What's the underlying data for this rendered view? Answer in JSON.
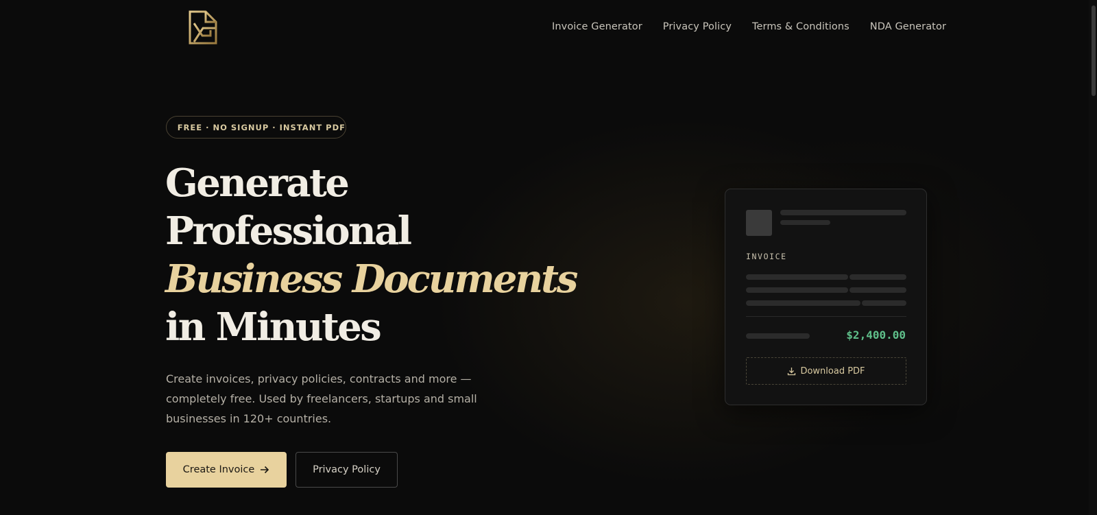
{
  "brand": {
    "logo_icon": "document-g-logo-icon",
    "accent_color": "#e8d29e",
    "amount_color": "#5fbf8a"
  },
  "nav": {
    "items": [
      {
        "label": "Invoice Generator"
      },
      {
        "label": "Privacy Policy"
      },
      {
        "label": "Terms & Conditions"
      },
      {
        "label": "NDA Generator"
      }
    ]
  },
  "hero": {
    "badge": "FREE · NO SIGNUP · INSTANT PDF",
    "badge_icon": "sparkle-icon",
    "headline": {
      "line1": "Generate",
      "line2": "Professional",
      "line3": "Business Documents",
      "line4": "in Minutes"
    },
    "subtext": "Create invoices, privacy policies, contracts and more — completely free. Used by freelancers, startups and small businesses in 120+ countries.",
    "primary_button": "Create Invoice",
    "primary_button_icon": "arrow-right-icon",
    "secondary_button": "Privacy Policy"
  },
  "invoice_card": {
    "label": "INVOICE",
    "amount": "$2,400.00",
    "download_label": "Download PDF",
    "download_icon": "download-icon"
  }
}
